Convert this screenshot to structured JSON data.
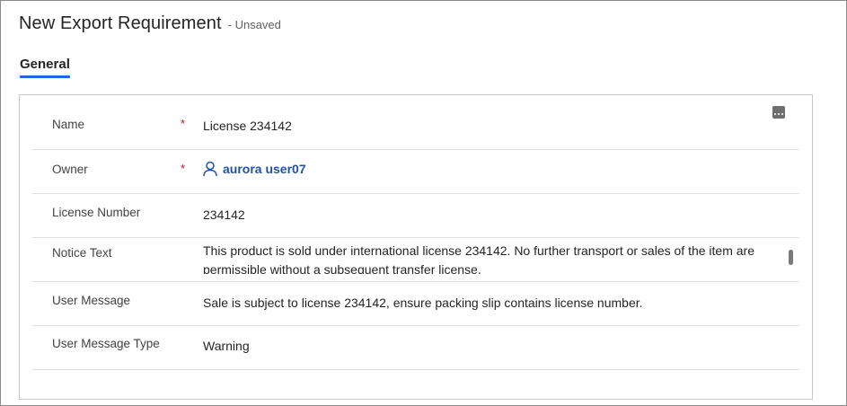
{
  "header": {
    "title": "New Export Requirement",
    "status": "- Unsaved"
  },
  "tabs": [
    {
      "label": "General",
      "active": true
    }
  ],
  "form": {
    "name": {
      "label": "Name",
      "required_mark": "*",
      "value": "License 234142"
    },
    "owner": {
      "label": "Owner",
      "required_mark": "*",
      "value": "aurora user07"
    },
    "license_number": {
      "label": "License Number",
      "value": "234142"
    },
    "notice_text": {
      "label": "Notice Text",
      "value": "This product is sold under international license 234142. No further transport or sales of the item are permissible without a subsequent transfer license."
    },
    "user_message": {
      "label": "User Message",
      "value": "Sale is subject to license 234142, ensure packing slip contains license number."
    },
    "user_message_type": {
      "label": "User Message Type",
      "value": "Warning"
    }
  },
  "icons": {
    "more": "more-options-icon",
    "owner": "person-icon"
  },
  "colors": {
    "accent": "#2266e3",
    "link": "#2150a8",
    "required": "#c50f1f"
  }
}
